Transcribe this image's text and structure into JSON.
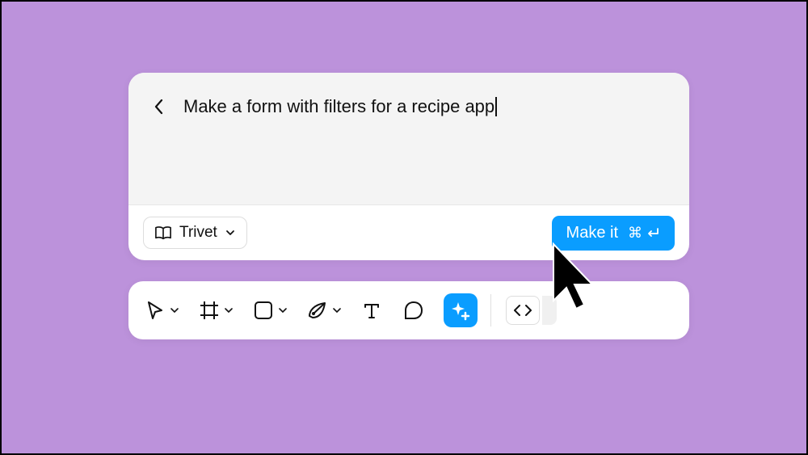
{
  "prompt": {
    "text": "Make a form with filters for a recipe app"
  },
  "project": {
    "name": "Trivet"
  },
  "makeButton": {
    "label": "Make it",
    "shortcut_cmd": "⌘",
    "shortcut_enter": "↩"
  },
  "toolbar": {
    "tools": [
      "select",
      "frame",
      "shape",
      "pen",
      "text",
      "comment",
      "ai"
    ]
  }
}
